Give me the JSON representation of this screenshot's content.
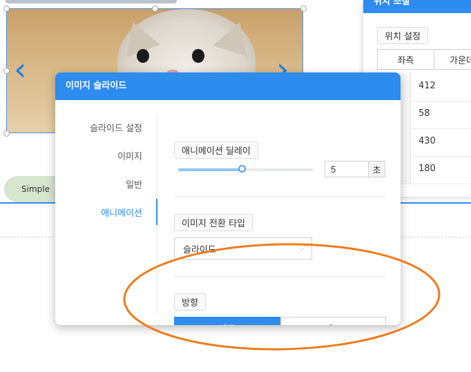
{
  "simple_button": {
    "label": "Simple ⬜"
  },
  "position_panel": {
    "header": "위치 조절",
    "section_label": "위치 설정",
    "align_left": "좌측",
    "align_center": "가운데",
    "rows": [
      {
        "value": "412"
      },
      {
        "value": "58"
      },
      {
        "value": "430"
      },
      {
        "value": "180"
      }
    ]
  },
  "modal": {
    "title": "이미지 슬라이드",
    "nav": [
      {
        "label": "슬라이드 설정"
      },
      {
        "label": "이미지"
      },
      {
        "label": "일반"
      },
      {
        "label": "애니메이션"
      }
    ],
    "active_nav": "애니메이션",
    "delay": {
      "label": "애니메이션 딜레이",
      "value": "5",
      "unit": "초",
      "slider_fraction": 0.47
    },
    "transition": {
      "label": "이미지 전환 타입",
      "selected": "슬라이드"
    },
    "direction": {
      "label": "방향",
      "horizontal": "가로",
      "vertical": "세로",
      "selected": "가로"
    }
  },
  "colors": {
    "accent": "#2d8cf0",
    "annotation": "#f07a1a"
  }
}
